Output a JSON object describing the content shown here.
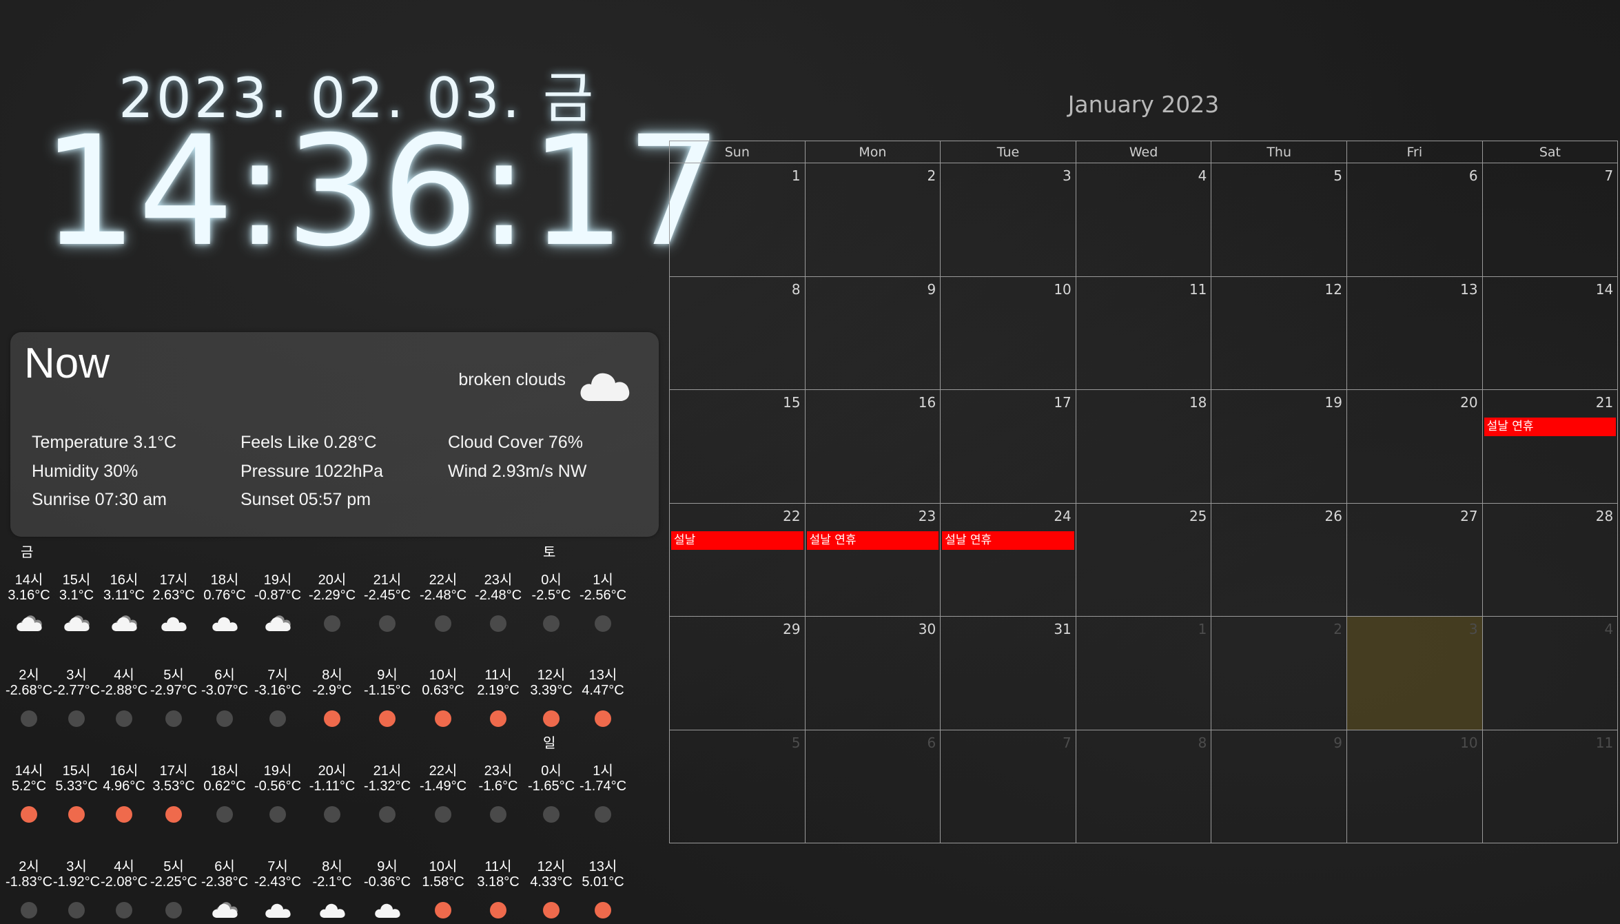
{
  "clock": {
    "date": "2023. 02. 03. 금",
    "time": "14:36:17"
  },
  "now": {
    "title": "Now",
    "description": "broken clouds",
    "icon": "cloud-icon",
    "rows": [
      [
        "Temperature 3.1°C",
        "Feels Like 0.28°C",
        "Cloud Cover 76%"
      ],
      [
        "Humidity 30%",
        "Pressure 1022hPa",
        "Wind 2.93m/s NW"
      ],
      [
        "Sunrise 07:30 am",
        "Sunset 05:57 pm",
        ""
      ]
    ]
  },
  "hourly": {
    "colors": {
      "gray": "#4a4a4a",
      "orange": "#ef6a4c"
    },
    "blocks": [
      {
        "days": [
          {
            "label": "금",
            "col": 0
          },
          {
            "label": "토",
            "col": 10
          }
        ],
        "hours": [
          {
            "time": "14시",
            "temp": "3.16°C",
            "icon": "cloud-small-icon"
          },
          {
            "time": "15시",
            "temp": "3.1°C",
            "icon": "cloud-small-icon"
          },
          {
            "time": "16시",
            "temp": "3.11°C",
            "icon": "cloud-small-icon"
          },
          {
            "time": "17시",
            "temp": "2.63°C",
            "icon": "cloud-white-icon"
          },
          {
            "time": "18시",
            "temp": "0.76°C",
            "icon": "cloud-white-icon"
          },
          {
            "time": "19시",
            "temp": "-0.87°C",
            "icon": "cloud-small-icon"
          },
          {
            "time": "20시",
            "temp": "-2.29°C",
            "icon": "gray-dot"
          },
          {
            "time": "21시",
            "temp": "-2.45°C",
            "icon": "gray-dot"
          },
          {
            "time": "22시",
            "temp": "-2.48°C",
            "icon": "gray-dot"
          },
          {
            "time": "23시",
            "temp": "-2.48°C",
            "icon": "gray-dot"
          },
          {
            "time": "0시",
            "temp": "-2.5°C",
            "icon": "gray-dot"
          },
          {
            "time": "1시",
            "temp": "-2.56°C",
            "icon": "gray-dot"
          }
        ]
      },
      {
        "days": [],
        "hours": [
          {
            "time": "2시",
            "temp": "-2.68°C",
            "icon": "gray-dot"
          },
          {
            "time": "3시",
            "temp": "-2.77°C",
            "icon": "gray-dot"
          },
          {
            "time": "4시",
            "temp": "-2.88°C",
            "icon": "gray-dot"
          },
          {
            "time": "5시",
            "temp": "-2.97°C",
            "icon": "gray-dot"
          },
          {
            "time": "6시",
            "temp": "-3.07°C",
            "icon": "gray-dot"
          },
          {
            "time": "7시",
            "temp": "-3.16°C",
            "icon": "gray-dot"
          },
          {
            "time": "8시",
            "temp": "-2.9°C",
            "icon": "orange-dot"
          },
          {
            "time": "9시",
            "temp": "-1.15°C",
            "icon": "orange-dot"
          },
          {
            "time": "10시",
            "temp": "0.63°C",
            "icon": "orange-dot"
          },
          {
            "time": "11시",
            "temp": "2.19°C",
            "icon": "orange-dot"
          },
          {
            "time": "12시",
            "temp": "3.39°C",
            "icon": "orange-dot"
          },
          {
            "time": "13시",
            "temp": "4.47°C",
            "icon": "orange-dot"
          }
        ]
      },
      {
        "days": [
          {
            "label": "일",
            "col": 10
          }
        ],
        "hours": [
          {
            "time": "14시",
            "temp": "5.2°C",
            "icon": "orange-dot"
          },
          {
            "time": "15시",
            "temp": "5.33°C",
            "icon": "orange-dot"
          },
          {
            "time": "16시",
            "temp": "4.96°C",
            "icon": "orange-dot"
          },
          {
            "time": "17시",
            "temp": "3.53°C",
            "icon": "orange-dot"
          },
          {
            "time": "18시",
            "temp": "0.62°C",
            "icon": "gray-dot"
          },
          {
            "time": "19시",
            "temp": "-0.56°C",
            "icon": "gray-dot"
          },
          {
            "time": "20시",
            "temp": "-1.11°C",
            "icon": "gray-dot"
          },
          {
            "time": "21시",
            "temp": "-1.32°C",
            "icon": "gray-dot"
          },
          {
            "time": "22시",
            "temp": "-1.49°C",
            "icon": "gray-dot"
          },
          {
            "time": "23시",
            "temp": "-1.6°C",
            "icon": "gray-dot"
          },
          {
            "time": "0시",
            "temp": "-1.65°C",
            "icon": "gray-dot"
          },
          {
            "time": "1시",
            "temp": "-1.74°C",
            "icon": "gray-dot"
          }
        ]
      },
      {
        "days": [],
        "hours": [
          {
            "time": "2시",
            "temp": "-1.83°C",
            "icon": "gray-dot"
          },
          {
            "time": "3시",
            "temp": "-1.92°C",
            "icon": "gray-dot"
          },
          {
            "time": "4시",
            "temp": "-2.08°C",
            "icon": "gray-dot"
          },
          {
            "time": "5시",
            "temp": "-2.25°C",
            "icon": "gray-dot"
          },
          {
            "time": "6시",
            "temp": "-2.38°C",
            "icon": "cloud-small-icon"
          },
          {
            "time": "7시",
            "temp": "-2.43°C",
            "icon": "cloud-white-icon"
          },
          {
            "time": "8시",
            "temp": "-2.1°C",
            "icon": "cloud-white-icon"
          },
          {
            "time": "9시",
            "temp": "-0.36°C",
            "icon": "cloud-white-icon"
          },
          {
            "time": "10시",
            "temp": "1.58°C",
            "icon": "orange-dot"
          },
          {
            "time": "11시",
            "temp": "3.18°C",
            "icon": "orange-dot"
          },
          {
            "time": "12시",
            "temp": "4.33°C",
            "icon": "orange-dot"
          },
          {
            "time": "13시",
            "temp": "5.01°C",
            "icon": "orange-dot"
          }
        ]
      }
    ]
  },
  "calendar": {
    "title": "January 2023",
    "weekdays": [
      "Sun",
      "Mon",
      "Tue",
      "Wed",
      "Thu",
      "Fri",
      "Sat"
    ],
    "event_color": "#ff0000",
    "today_color": "#786420",
    "weeks": [
      [
        {
          "day": "1",
          "other": false
        },
        {
          "day": "2",
          "other": false
        },
        {
          "day": "3",
          "other": false
        },
        {
          "day": "4",
          "other": false
        },
        {
          "day": "5",
          "other": false
        },
        {
          "day": "6",
          "other": false
        },
        {
          "day": "7",
          "other": false
        }
      ],
      [
        {
          "day": "8",
          "other": false
        },
        {
          "day": "9",
          "other": false
        },
        {
          "day": "10",
          "other": false
        },
        {
          "day": "11",
          "other": false
        },
        {
          "day": "12",
          "other": false
        },
        {
          "day": "13",
          "other": false
        },
        {
          "day": "14",
          "other": false
        }
      ],
      [
        {
          "day": "15",
          "other": false
        },
        {
          "day": "16",
          "other": false
        },
        {
          "day": "17",
          "other": false
        },
        {
          "day": "18",
          "other": false
        },
        {
          "day": "19",
          "other": false
        },
        {
          "day": "20",
          "other": false
        },
        {
          "day": "21",
          "other": false,
          "event": "설날 연휴"
        }
      ],
      [
        {
          "day": "22",
          "other": false,
          "event": "설날"
        },
        {
          "day": "23",
          "other": false,
          "event": "설날 연휴"
        },
        {
          "day": "24",
          "other": false,
          "event": "설날 연휴"
        },
        {
          "day": "25",
          "other": false
        },
        {
          "day": "26",
          "other": false
        },
        {
          "day": "27",
          "other": false
        },
        {
          "day": "28",
          "other": false
        }
      ],
      [
        {
          "day": "29",
          "other": false
        },
        {
          "day": "30",
          "other": false
        },
        {
          "day": "31",
          "other": false
        },
        {
          "day": "1",
          "other": true
        },
        {
          "day": "2",
          "other": true
        },
        {
          "day": "3",
          "other": true,
          "today": true
        },
        {
          "day": "4",
          "other": true
        }
      ],
      [
        {
          "day": "5",
          "other": true
        },
        {
          "day": "6",
          "other": true
        },
        {
          "day": "7",
          "other": true
        },
        {
          "day": "8",
          "other": true
        },
        {
          "day": "9",
          "other": true
        },
        {
          "day": "10",
          "other": true
        },
        {
          "day": "11",
          "other": true
        }
      ]
    ]
  }
}
